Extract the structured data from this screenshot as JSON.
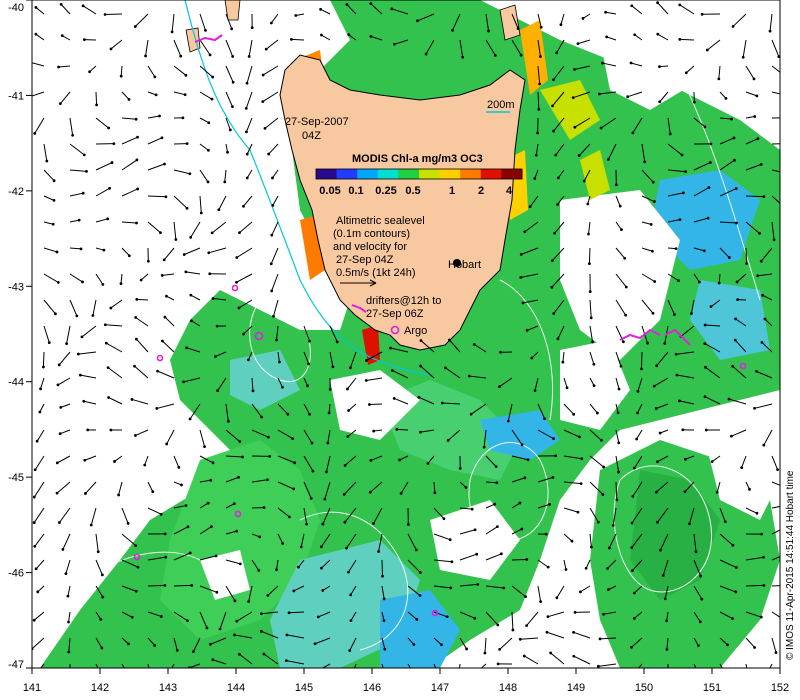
{
  "map": {
    "date_label": "27-Sep-2007",
    "time_label": "04Z",
    "scale_bar_label": "200m",
    "colorbar": {
      "title": "MODIS Chl-a mg/m3 OC3",
      "ticks": [
        "0.05",
        "0.1",
        "0.25",
        "0.5",
        "1",
        "2",
        "4"
      ],
      "colors": [
        "#2a0a8c",
        "#1f3cff",
        "#00a6ff",
        "#00e0d0",
        "#20d040",
        "#c8e000",
        "#ffd000",
        "#ff7a00",
        "#e01000",
        "#8a0000"
      ]
    },
    "altimetry_note": [
      "Altimetric sealevel",
      "(0.1m contours)",
      "and velocity for",
      "27-Sep 04Z",
      "0.5m/s (1kt 24h)"
    ],
    "place_label": "Hobart",
    "drifters_note": [
      "drifters@12h to",
      "27-Sep 06Z"
    ],
    "argo_label": "Argo",
    "credit": "© IMOS 11-Apr-2015 14:51:44 Hobart time",
    "colors": {
      "land": "#f8c8a0",
      "chlorophyll_main": "#33c24d",
      "ocean_blue": "#33b5e8",
      "drifter": "#e020e0",
      "contour": "#ffffff",
      "coast_line": "#00c8d8"
    }
  },
  "axes": {
    "x_ticks": [
      "141",
      "142",
      "143",
      "144",
      "145",
      "146",
      "147",
      "148",
      "149",
      "150",
      "151",
      "152"
    ],
    "y_ticks": [
      "-40",
      "-41",
      "-42",
      "-43",
      "-44",
      "-45",
      "-46",
      "-47"
    ]
  }
}
